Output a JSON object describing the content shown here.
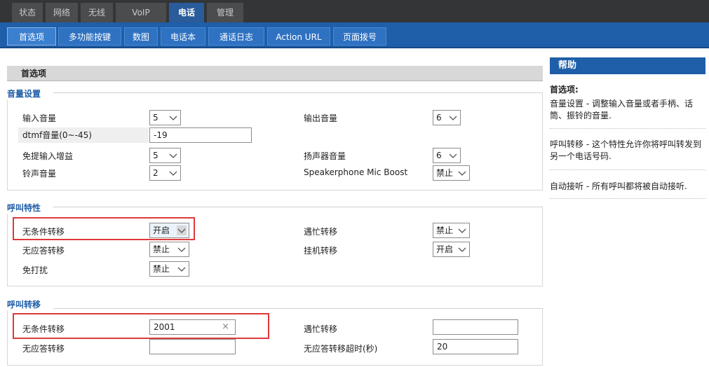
{
  "top_tabs": [
    {
      "label": "状态",
      "active": false
    },
    {
      "label": "网络",
      "active": false
    },
    {
      "label": "无线",
      "active": false
    },
    {
      "label": "VoIP",
      "active": false
    },
    {
      "label": "电话",
      "active": true
    },
    {
      "label": "管理",
      "active": false
    }
  ],
  "sub_tabs": [
    {
      "label": "首选项",
      "active": true
    },
    {
      "label": "多功能按键",
      "active": false
    },
    {
      "label": "数图",
      "active": false
    },
    {
      "label": "电话本",
      "active": false
    },
    {
      "label": "通话日志",
      "active": false
    },
    {
      "label": "Action URL",
      "active": false
    },
    {
      "label": "页面拨号",
      "active": false
    }
  ],
  "page_title": "首选项",
  "volume": {
    "legend": "音量设置",
    "input_volume_label": "输入音量",
    "input_volume_value": "5",
    "output_volume_label": "输出音量",
    "output_volume_value": "6",
    "dtmf_label": "dtmf音量(0~-45)",
    "dtmf_value": "-19",
    "handsfree_gain_label": "免提输入增益",
    "handsfree_gain_value": "5",
    "speaker_volume_label": "扬声器音量",
    "speaker_volume_value": "6",
    "ring_volume_label": "铃声音量",
    "ring_volume_value": "2",
    "mic_boost_label": "Speakerphone Mic Boost",
    "mic_boost_value": "禁止"
  },
  "call_features": {
    "legend": "呼叫特性",
    "unconditional_label": "无条件转移",
    "unconditional_value": "开启",
    "busy_label": "遇忙转移",
    "busy_value": "禁止",
    "no_answer_label": "无应答转移",
    "no_answer_value": "禁止",
    "onhook_label": "挂机转移",
    "onhook_value": "开启",
    "dnd_label": "免打扰",
    "dnd_value": "禁止"
  },
  "call_forward": {
    "legend": "呼叫转移",
    "unconditional_label": "无条件转移",
    "unconditional_value": "2001",
    "busy_label": "遇忙转移",
    "busy_value": "",
    "no_answer_label": "无应答转移",
    "no_answer_value": "",
    "timeout_label": "无应答转移超时(秒)",
    "timeout_value": "20"
  },
  "help": {
    "title": "帮助",
    "heading": "首选项:",
    "item1": "音量设置 - 调整输入音量或者手柄、话筒、振铃的音量.",
    "item2": "呼叫转移 - 这个特性允许你将呼叫转发到另一个电话号码.",
    "item3": "自动接听 - 所有呼叫都将被自动接听."
  },
  "colors": {
    "nav_blue": "#1f5ea8",
    "highlight_red": "#e0383b"
  }
}
